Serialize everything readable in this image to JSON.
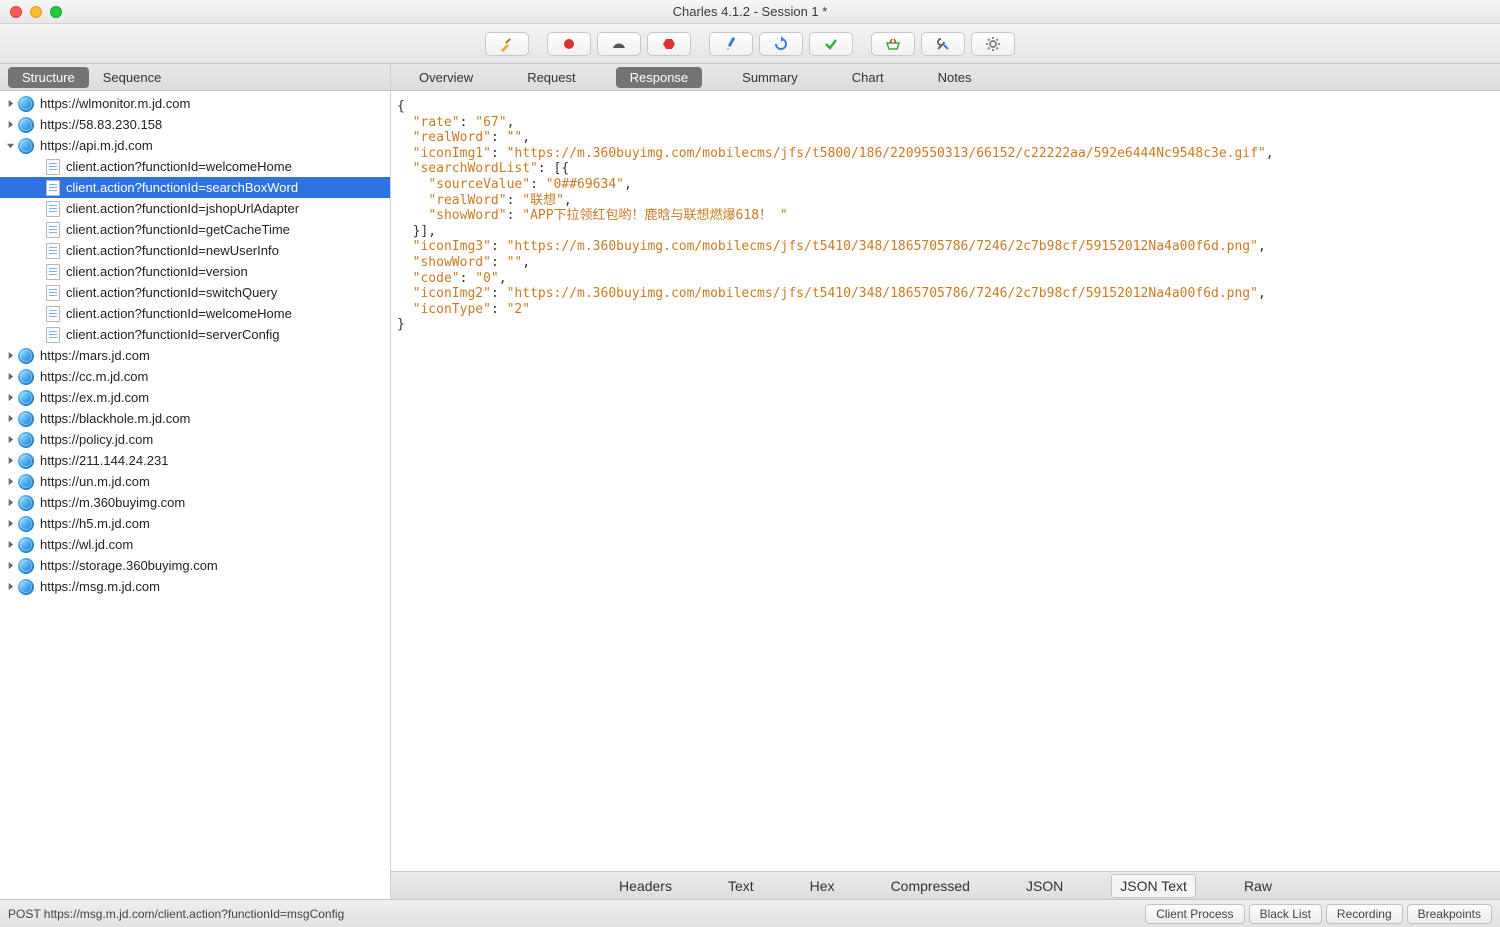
{
  "window": {
    "title": "Charles 4.1.2 - Session 1 *"
  },
  "leftTabs": {
    "structure": "Structure",
    "sequence": "Sequence"
  },
  "rightTabs": {
    "overview": "Overview",
    "request": "Request",
    "response": "Response",
    "summary": "Summary",
    "chart": "Chart",
    "notes": "Notes"
  },
  "tree": {
    "hosts": [
      {
        "label": "https://wlmonitor.m.jd.com",
        "expanded": false
      },
      {
        "label": "https://58.83.230.158",
        "expanded": false
      },
      {
        "label": "https://api.m.jd.com",
        "expanded": true,
        "children": [
          {
            "label": "client.action?functionId=welcomeHome"
          },
          {
            "label": "client.action?functionId=searchBoxWord",
            "selected": true
          },
          {
            "label": "client.action?functionId=jshopUrlAdapter"
          },
          {
            "label": "client.action?functionId=getCacheTime"
          },
          {
            "label": "client.action?functionId=newUserInfo"
          },
          {
            "label": "client.action?functionId=version"
          },
          {
            "label": "client.action?functionId=switchQuery"
          },
          {
            "label": "client.action?functionId=welcomeHome"
          },
          {
            "label": "client.action?functionId=serverConfig"
          }
        ]
      },
      {
        "label": "https://mars.jd.com",
        "expanded": false
      },
      {
        "label": "https://cc.m.jd.com",
        "expanded": false
      },
      {
        "label": "https://ex.m.jd.com",
        "expanded": false
      },
      {
        "label": "https://blackhole.m.jd.com",
        "expanded": false
      },
      {
        "label": "https://policy.jd.com",
        "expanded": false
      },
      {
        "label": "https://211.144.24.231",
        "expanded": false
      },
      {
        "label": "https://un.m.jd.com",
        "expanded": false
      },
      {
        "label": "https://m.360buyimg.com",
        "expanded": false
      },
      {
        "label": "https://h5.m.jd.com",
        "expanded": false
      },
      {
        "label": "https://wl.jd.com",
        "expanded": false
      },
      {
        "label": "https://storage.360buyimg.com",
        "expanded": false
      },
      {
        "label": "https://msg.m.jd.com",
        "expanded": false
      }
    ]
  },
  "responseJson": {
    "rate": "67",
    "realWord": "",
    "iconImg1": "https://m.360buyimg.com/mobilecms/jfs/t5800/186/2209550313/66152/c22222aa/592e6444Nc9548c3e.gif",
    "searchWordList_sourceValue": "0##69634",
    "searchWordList_realWord": "联想",
    "searchWordList_showWord": "APP下拉领红包哟！鹿晗与联想燃爆618！",
    "iconImg3": "https://m.360buyimg.com/mobilecms/jfs/t5410/348/1865705786/7246/2c7b98cf/59152012Na4a00f6d.png",
    "showWord": "",
    "code": "0",
    "iconImg2": "https://m.360buyimg.com/mobilecms/jfs/t5410/348/1865705786/7246/2c7b98cf/59152012Na4a00f6d.png",
    "iconType": "2"
  },
  "bottomTabs": {
    "headers": "Headers",
    "text": "Text",
    "hex": "Hex",
    "compressed": "Compressed",
    "json": "JSON",
    "jsontext": "JSON Text",
    "raw": "Raw"
  },
  "status": {
    "left": "POST https://msg.m.jd.com/client.action?functionId=msgConfig",
    "pills": {
      "client": "Client Process",
      "blacklist": "Black List",
      "recording": "Recording",
      "breakpoints": "Breakpoints"
    }
  }
}
